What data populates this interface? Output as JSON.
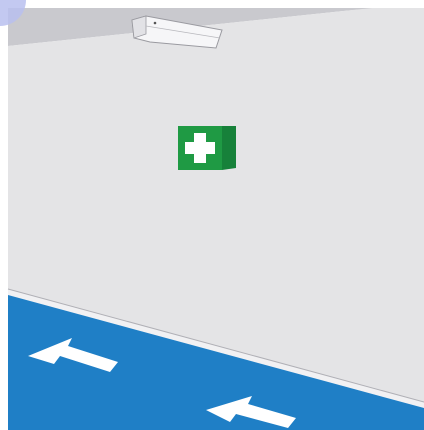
{
  "scene": {
    "description_label": "",
    "colors": {
      "wall": "#e4e4e6",
      "ceiling": "#c7c7cc",
      "floor": "#1f7fc6",
      "floor_edge": "#3d86c2",
      "baseboard": "#f1f1f3",
      "first_aid_green": "#1f9a44",
      "first_aid_green_dark": "#17813a",
      "arrow": "#ffffff",
      "corner_circle": "#b9bfee"
    },
    "icons": {
      "light_fixture": "ceiling-light-icon",
      "first_aid": "first-aid-sign-icon",
      "floor_arrow": "floor-arrow-icon"
    },
    "floor_arrow_count": 2
  }
}
